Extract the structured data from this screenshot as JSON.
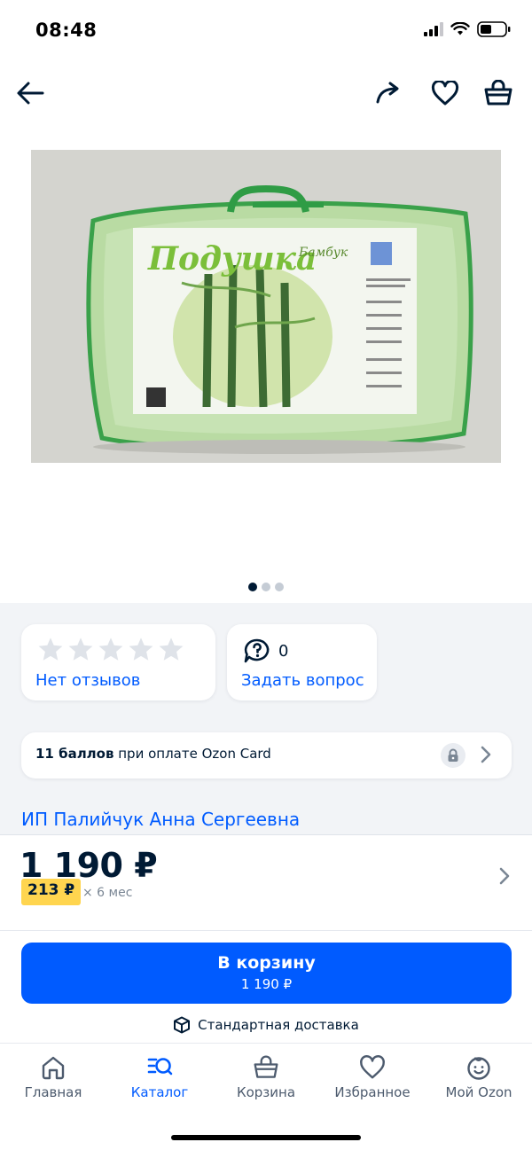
{
  "status_bar": {
    "time": "08:48"
  },
  "top_nav": {
    "back_icon": "arrow-left-icon",
    "share_icon": "share-arrow-icon",
    "favorite_icon": "heart-icon",
    "cart_icon": "basket-icon"
  },
  "gallery": {
    "product_packaging_title": "Подушка",
    "product_packaging_subtitle": "Бамбук",
    "image_count": 3,
    "active_index": 0
  },
  "rating": {
    "stars_filled": 0,
    "stars_total": 5,
    "no_reviews_label": "Нет отзывов"
  },
  "questions": {
    "count": "0",
    "ask_label": "Задать вопрос"
  },
  "bonus": {
    "points": "11 баллов",
    "text": "при оплате Ozon Card"
  },
  "seller": {
    "name": "ИП Палийчук Анна Сергеевна"
  },
  "price": {
    "amount": "1 190 ₽",
    "installment": "213 ₽",
    "installment_term": "× 6 мес"
  },
  "buy": {
    "button_label": "В корзину",
    "button_price": "1 190 ₽",
    "delivery_label": "Стандартная доставка"
  },
  "tabbar": {
    "items": [
      {
        "label": "Главная",
        "icon": "home-icon",
        "active": false
      },
      {
        "label": "Каталог",
        "icon": "catalog-search-icon",
        "active": true
      },
      {
        "label": "Корзина",
        "icon": "basket-icon",
        "active": false
      },
      {
        "label": "Избранное",
        "icon": "heart-icon",
        "active": false
      },
      {
        "label": "Мой Ozon",
        "icon": "smile-face-icon",
        "active": false
      }
    ]
  },
  "colors": {
    "accent": "#005bff",
    "text": "#001a34",
    "installment_badge": "#ffd54f"
  }
}
